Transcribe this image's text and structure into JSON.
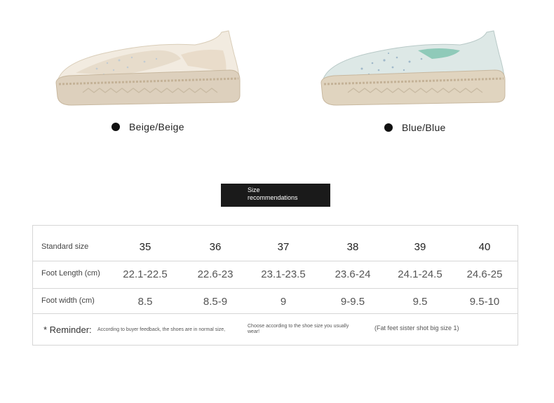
{
  "variants": [
    {
      "label": "Beige/Beige",
      "color": "#eadfcd"
    },
    {
      "label": "Blue/Blue",
      "color": "#cfe0de"
    }
  ],
  "section_title": "Size recommendations",
  "size_table": {
    "row_labels": [
      "Standard size",
      "Foot Length (cm)",
      "Foot width (cm)"
    ],
    "standard_size": [
      "35",
      "36",
      "37",
      "38",
      "39",
      "40"
    ],
    "foot_length": [
      "22.1-22.5",
      "22.6-23",
      "23.1-23.5",
      "23.6-24",
      "24.1-24.5",
      "24.6-25"
    ],
    "foot_width": [
      "8.5",
      "8.5-9",
      "9",
      "9-9.5",
      "9.5",
      "9.5-10"
    ]
  },
  "reminder": {
    "label": "* Reminder:",
    "note_1": "According to buyer feedback, the shoes are in normal size,",
    "note_2": "Choose according to the shoe size you usually wear!",
    "note_3": "(Fat feet sister shot big size 1)"
  }
}
